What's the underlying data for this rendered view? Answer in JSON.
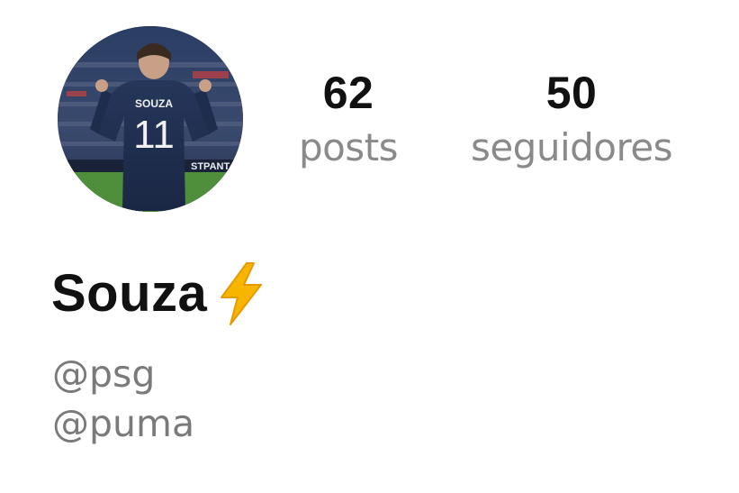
{
  "profile": {
    "avatar_icon": "profile-photo-jersey-icon",
    "jersey_name": "SOUZA",
    "jersey_number": "11",
    "display_name": "Souza",
    "name_emoji_icon": "lightning-bolt-icon",
    "bio": [
      "@psg",
      "@puma"
    ]
  },
  "stats": {
    "posts": {
      "value": "62",
      "label": "posts"
    },
    "followers": {
      "value": "50",
      "label": "seguidores"
    }
  },
  "colors": {
    "name": "#111111",
    "label": "#8a8a8a",
    "bio": "#7a7a7a",
    "bolt": "#f7b500"
  }
}
